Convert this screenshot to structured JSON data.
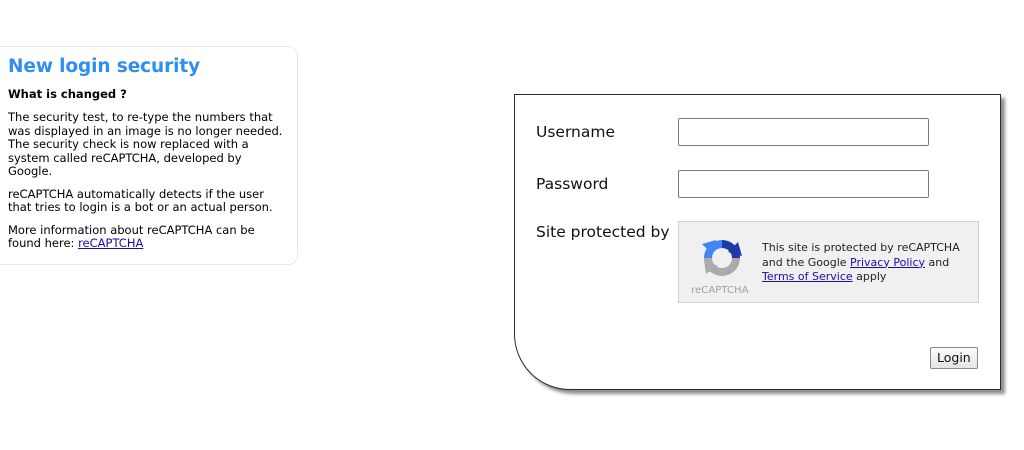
{
  "info": {
    "title": "New login security",
    "subtitle": "What is changed ?",
    "paragraph1": "The security test, to re-type the numbers that was displayed in an image is no longer needed. The security check is now replaced with a system called reCAPTCHA, developed by Google.",
    "paragraph2": "reCAPTCHA automatically detects if the user that tries to login is a bot or an actual person.",
    "paragraph3_prefix": "More information about reCAPTCHA can be found here: ",
    "paragraph3_link": "reCAPTCHA"
  },
  "login": {
    "username_label": "Username",
    "username_value": "",
    "password_label": "Password",
    "password_value": "",
    "protected_label": "Site protected by",
    "login_button": "Login"
  },
  "recaptcha": {
    "logo_icon": "recaptcha-logo-icon",
    "wordmark": "reCAPTCHA",
    "text_line1": "This site is protected by reCAPTCHA and the Google ",
    "privacy_link": "Privacy Policy",
    "text_and": " and",
    "terms_link": "Terms of Service",
    "text_apply": " apply",
    "colors": {
      "blue": "#1c3aa9",
      "light_blue": "#4285f4",
      "grey": "#ababab"
    }
  },
  "colors": {
    "title_blue": "#2f8ff0",
    "link": "#1a0dab"
  }
}
